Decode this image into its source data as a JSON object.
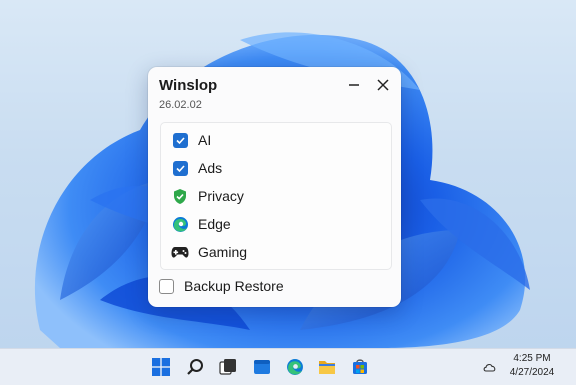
{
  "window": {
    "title": "Winslop",
    "version": "26.02.02",
    "minimize_icon": "minimize-icon",
    "close_icon": "close-icon"
  },
  "options": [
    {
      "label": "AI",
      "icon": "checkbox-checked"
    },
    {
      "label": "Ads",
      "icon": "checkbox-checked"
    },
    {
      "label": "Privacy",
      "icon": "shield-check-icon"
    },
    {
      "label": "Edge",
      "icon": "edge-icon"
    },
    {
      "label": "Gaming",
      "icon": "gamepad-icon"
    }
  ],
  "backup": {
    "label": "Backup Restore",
    "checked": false
  },
  "taskbar": {
    "icons": [
      "start-icon",
      "search-icon",
      "task-view-icon",
      "file-explorer-icon",
      "edge-icon",
      "folder-icon",
      "store-icon"
    ],
    "tray_icon": "cloud-icon",
    "time": "4:25 PM",
    "date": "4/27/2024"
  },
  "colors": {
    "accent": "#1f6fd0",
    "shield": "#2ea84a",
    "wallpaper": "#1658e0"
  }
}
